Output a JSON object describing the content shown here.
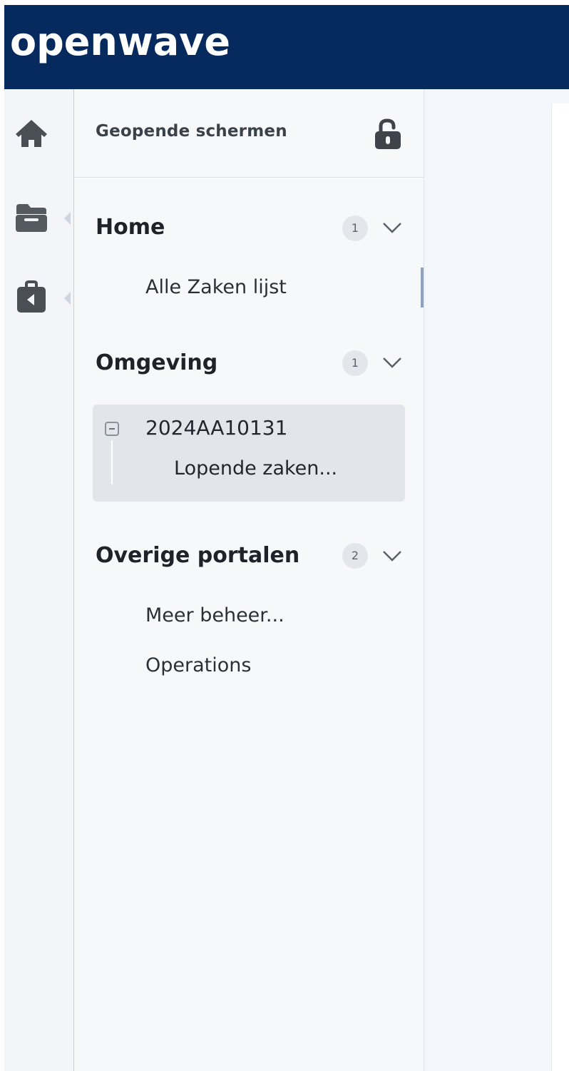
{
  "brand": {
    "logo_text": "openwave",
    "header_color": "#062a5e"
  },
  "rail": {
    "items": [
      {
        "icon": "home-icon"
      },
      {
        "icon": "folder-icon"
      },
      {
        "icon": "briefcase-icon"
      }
    ]
  },
  "panel": {
    "title": "Geopende schermen",
    "lock_icon": "unlock-icon",
    "sections": [
      {
        "title": "Home",
        "count": "1",
        "items": [
          "Alle Zaken lijst"
        ]
      },
      {
        "title": "Omgeving",
        "count": "1",
        "card": {
          "title": "2024AA10131",
          "subitem": "Lopende zaken..."
        }
      },
      {
        "title": "Overige portalen",
        "count": "2",
        "items": [
          "Meer beheer...",
          "Operations"
        ]
      }
    ]
  }
}
